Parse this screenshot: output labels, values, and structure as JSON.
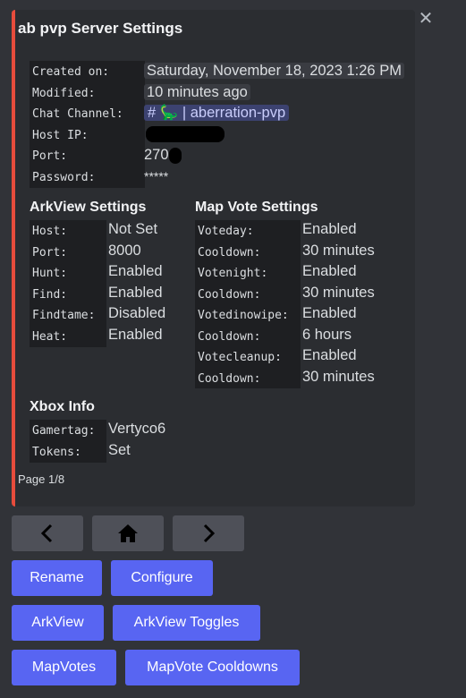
{
  "title": "ab pvp Server Settings",
  "server": {
    "labels": [
      "Created on:",
      "Modified:",
      "Chat Channel:",
      "Host IP:",
      "Port:",
      "Password:"
    ],
    "created": "Saturday, November 18, 2023 1:26 PM",
    "modified": "10 minutes ago",
    "channel": "# 🦕 | aberration-pvp",
    "port_partial": "270",
    "password": "*****"
  },
  "arkview": {
    "heading": "ArkView Settings",
    "labels": [
      "Host:",
      "Port:",
      "Hunt:",
      "Find:",
      "Findtame:",
      "Heat:"
    ],
    "values": [
      "Not Set",
      "8000",
      "Enabled",
      "Enabled",
      "Disabled",
      "Enabled"
    ]
  },
  "mapvote": {
    "heading": "Map Vote Settings",
    "labels": [
      "Voteday:",
      "Cooldown:",
      "Votenight:",
      "Cooldown:",
      "Votedinowipe:",
      "Cooldown:",
      "Votecleanup:",
      "Cooldown:"
    ],
    "values": [
      "Enabled",
      "30 minutes",
      "Enabled",
      "30 minutes",
      "Enabled",
      "6 hours",
      "Enabled",
      "30 minutes"
    ]
  },
  "xbox": {
    "heading": "Xbox Info",
    "labels": [
      "Gamertag:",
      "Tokens:"
    ],
    "values": [
      "Vertyco6",
      "Set"
    ]
  },
  "footer": "Page 1/8",
  "nav_buttons": [
    "prev-icon",
    "home-icon",
    "next-icon"
  ],
  "buttons": {
    "rename": "Rename",
    "configure": "Configure",
    "arkview": "ArkView",
    "arkview_toggles": "ArkView Toggles",
    "mapvotes": "MapVotes",
    "mapvote_cooldowns": "MapVote Cooldowns"
  },
  "colors": {
    "accent_bar": "#e74c3c",
    "blurple": "#5865f2",
    "grey_button": "#4e5058",
    "embed_bg": "#2b2d31"
  }
}
